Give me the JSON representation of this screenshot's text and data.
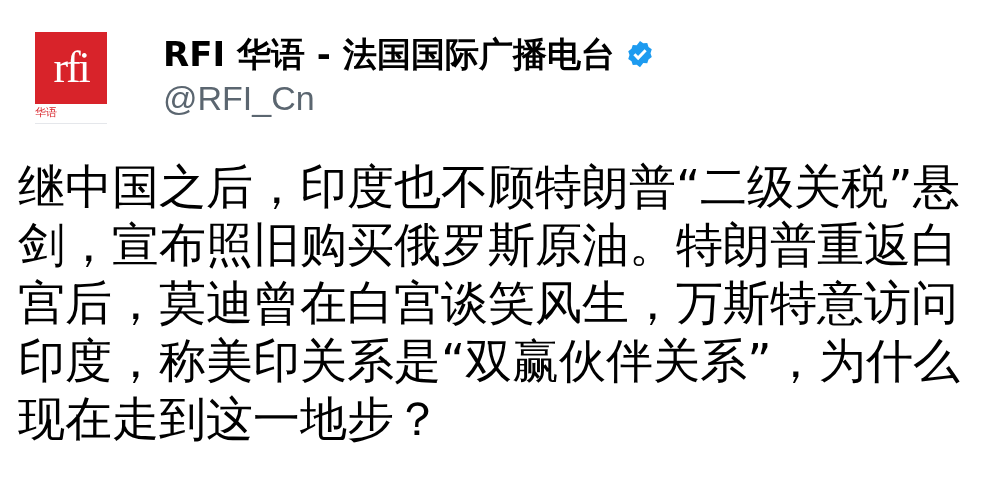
{
  "author": {
    "logo_text": "rfi",
    "logo_caption": "华语",
    "name": "RFI 华语 - 法国国际广播电台",
    "verified": true,
    "handle": "@RFI_Cn"
  },
  "post": {
    "text": "继中国之后，印度也不顾特朗普“二级关税”悬剑，宣布照旧购买俄罗斯原油。特朗普重返白宫后，莫迪曾在白宫谈笑风生，万斯特意访问印度，称美印关系是“双赢伙伴关系”，为什么现在走到这一地步？"
  }
}
